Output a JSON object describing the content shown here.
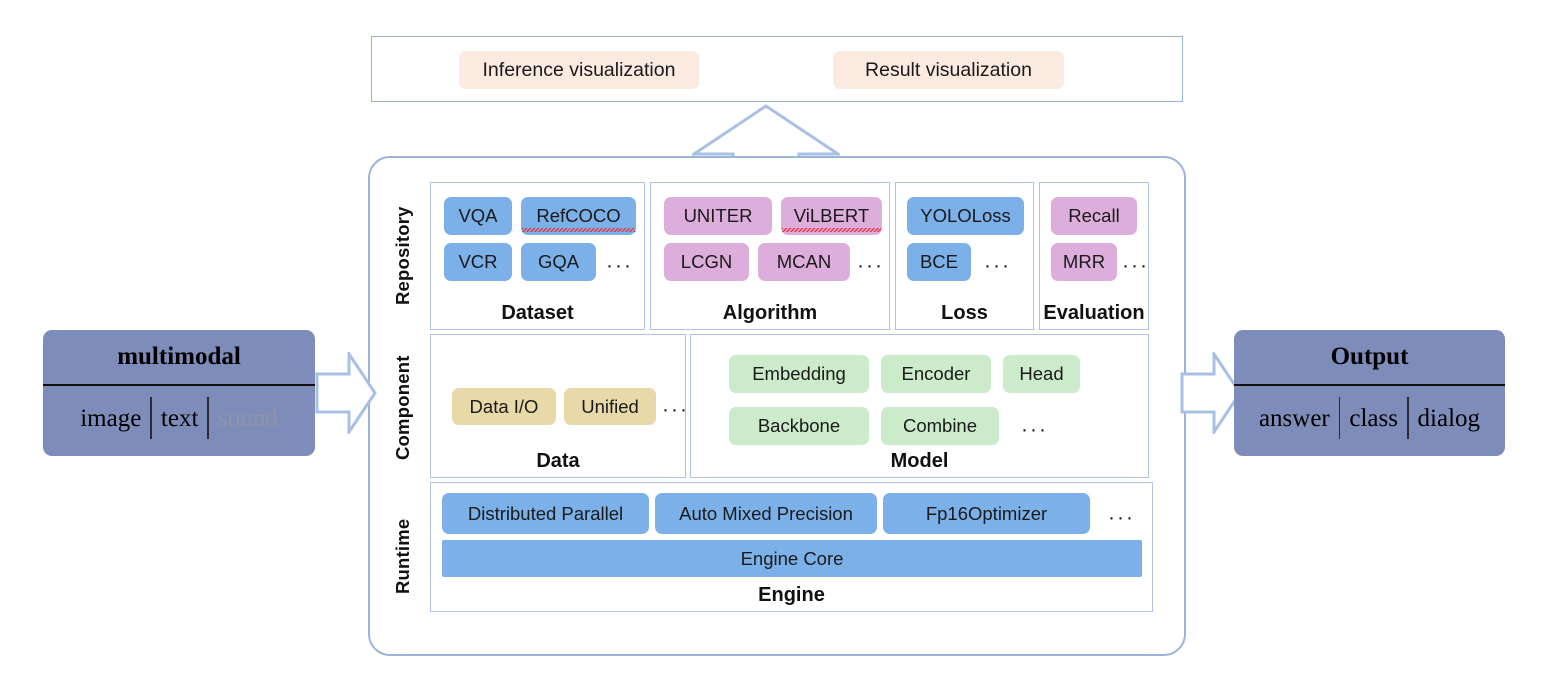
{
  "visualization_bar": {
    "items": [
      {
        "label": "Inference visualization"
      },
      {
        "label": "Result visualization"
      }
    ]
  },
  "framework": {
    "tiers": [
      {
        "name": "Repository"
      },
      {
        "name": "Component"
      },
      {
        "name": "Runtime"
      }
    ],
    "repository": {
      "groups": [
        {
          "title": "Dataset",
          "chip_color": "#7CB0E8",
          "chips": [
            {
              "label": "VQA",
              "misspelled": false
            },
            {
              "label": "RefCOCO",
              "misspelled": true
            },
            {
              "label": "VCR",
              "misspelled": false
            },
            {
              "label": "GQA",
              "misspelled": false
            }
          ],
          "more": "···"
        },
        {
          "title": "Algorithm",
          "chip_color": "#DDAEDB",
          "chips": [
            {
              "label": "UNITER",
              "misspelled": false
            },
            {
              "label": "ViLBERT",
              "misspelled": true
            },
            {
              "label": "LCGN",
              "misspelled": false
            },
            {
              "label": "MCAN",
              "misspelled": false
            }
          ],
          "more": "···"
        },
        {
          "title": "Loss",
          "chip_color": "#7CB0E8",
          "chips": [
            {
              "label": "YOLOLoss",
              "misspelled": true
            },
            {
              "label": "BCE",
              "misspelled": false
            }
          ],
          "more": "···"
        },
        {
          "title": "Evaluation",
          "chip_color": "#DDAEDB",
          "chips": [
            {
              "label": "Recall",
              "misspelled": false
            },
            {
              "label": "MRR",
              "misspelled": false
            }
          ],
          "more": "···"
        }
      ]
    },
    "component": {
      "groups": [
        {
          "title": "Data",
          "chip_color": "#E8D9A8",
          "chips": [
            {
              "label": "Data I/O"
            },
            {
              "label": "Unified"
            }
          ],
          "more": "···"
        },
        {
          "title": "Model",
          "chip_color": "#CBEBCB",
          "chips": [
            {
              "label": "Embedding"
            },
            {
              "label": "Encoder"
            },
            {
              "label": "Head"
            },
            {
              "label": "Backbone"
            },
            {
              "label": "Combine"
            }
          ],
          "more": "···"
        }
      ]
    },
    "runtime": {
      "title": "Engine",
      "chip_color": "#7CB0E8",
      "chips": [
        {
          "label": "Distributed Parallel"
        },
        {
          "label": "Auto Mixed Precision"
        },
        {
          "label": "Fp16Optimizer"
        }
      ],
      "more": "···",
      "core": {
        "label": "Engine Core"
      }
    }
  },
  "input_panel": {
    "title": "multimodal",
    "modalities": [
      {
        "label": "image",
        "dimmed": false
      },
      {
        "label": "text",
        "dimmed": false
      },
      {
        "label": "sound",
        "dimmed": true
      }
    ]
  },
  "output_panel": {
    "title": "Output",
    "outputs": [
      {
        "label": "answer"
      },
      {
        "label": "class"
      },
      {
        "label": "dialog"
      }
    ]
  },
  "colors": {
    "panel_fill": "#7E8CBA",
    "border_blue": "#9BB4DC",
    "chip_blue": "#7CB0E8",
    "chip_pink": "#DDAEDB",
    "chip_green": "#CBEBCB",
    "chip_tan": "#E8D9A8",
    "viz_peach": "#FBEAE0",
    "arrow_stroke": "#A8C0E4"
  }
}
